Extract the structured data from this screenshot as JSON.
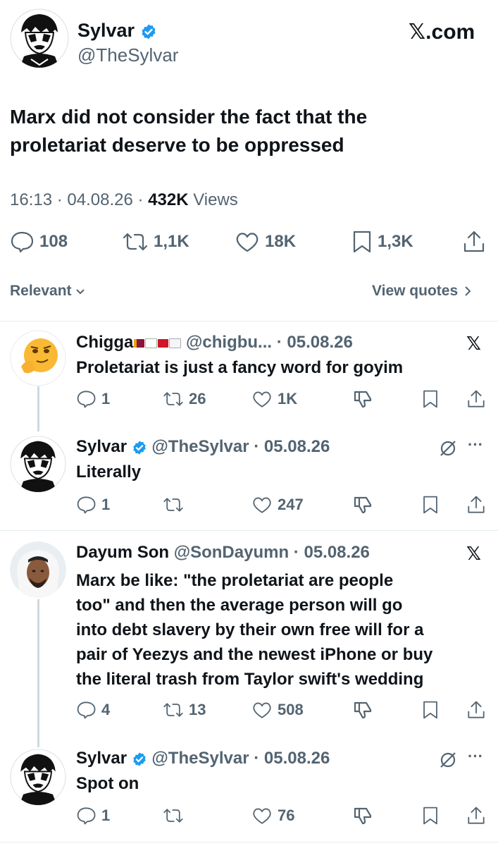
{
  "main_tweet": {
    "author_name": "Sylvar",
    "author_handle": "@TheSylvar",
    "site_label": "𝕏.com",
    "text_line1": "Marx did not consider the fact that the",
    "text_line2": "proletariat deserve to be oppressed",
    "time": "16:13",
    "date": "04.08.26",
    "views_count": "432K",
    "views_label": "Views",
    "replies": "108",
    "reposts": "1,1K",
    "likes": "18K",
    "bookmarks": "1,3K",
    "sort_label": "Relevant",
    "view_quotes_label": "View quotes"
  },
  "replies": [
    {
      "author_name": "Chigga",
      "author_handle": "@chigbu...",
      "date": "05.08.26",
      "text_lines": [
        "Proletariat is just a fancy word for goyim"
      ],
      "replies": "1",
      "reposts": "26",
      "likes": "1K"
    },
    {
      "author_name": "Sylvar",
      "author_handle": "@TheSylvar",
      "date": "05.08.26",
      "text_lines": [
        "Literally"
      ],
      "replies": "1",
      "reposts": "",
      "likes": "247"
    },
    {
      "author_name": "Dayum Son",
      "author_handle": "@SonDayumn",
      "date": "05.08.26",
      "text_lines": [
        "Marx be like: \"the proletariat are people",
        "too\" and then the average person will go",
        "into debt slavery by their own free will for a",
        "pair of Yeezys and the newest iPhone or buy",
        "the literal trash from Taylor swift's wedding"
      ],
      "replies": "4",
      "reposts": "13",
      "likes": "508"
    },
    {
      "author_name": "Sylvar",
      "author_handle": "@TheSylvar",
      "date": "05.08.26",
      "text_lines": [
        "Spot on"
      ],
      "replies": "1",
      "reposts": "",
      "likes": "76"
    }
  ],
  "colors": {
    "verified_blue": "#1d9bf0",
    "text_primary": "#0f1419",
    "text_secondary": "#536471"
  }
}
